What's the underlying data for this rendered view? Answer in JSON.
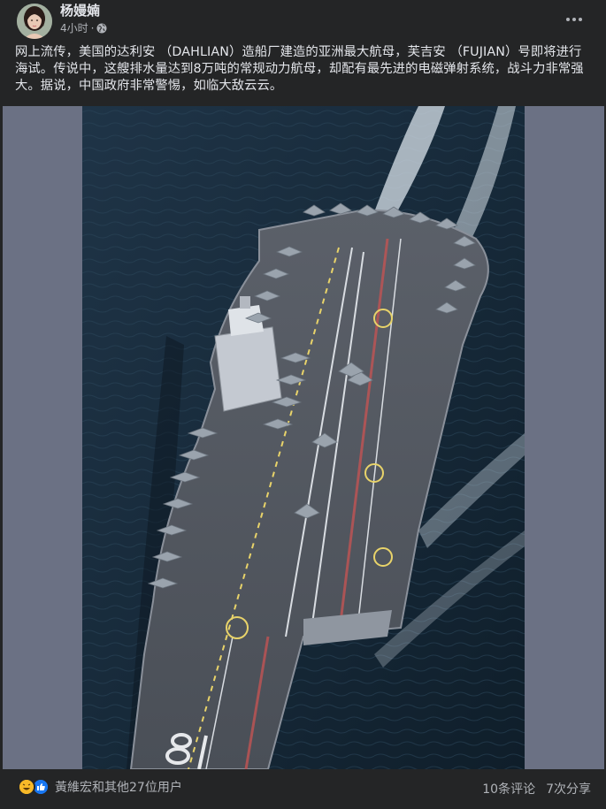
{
  "author": {
    "name": "杨嫚婻"
  },
  "post": {
    "time": "4小时",
    "separator": "·",
    "privacy_icon": "globe-icon",
    "text": "网上流传，美国的达利安 （DAHLIAN）造船厂建造的亚洲最大航母，芙吉安 （FUJIAN）号即将进行海试。传说中，这艘排水量达到8万吨的常规动力航母，却配有最先进的电磁弹射系统，战斗力非常强大。据说，中国政府非常警惕，如临大敌云云。",
    "image_subject": "aircraft-carrier-photo",
    "hull_number": "18"
  },
  "footer": {
    "reaction_icons": [
      "haha-icon",
      "like-icon"
    ],
    "reactions_text": "黃維宏和其他27位用户",
    "comments": "10条评论",
    "shares": "7次分享"
  },
  "colors": {
    "background": "#242526",
    "text_primary": "#e4e6eb",
    "text_secondary": "#b0b3b8",
    "media_frame": "#6b7184",
    "like_blue": "#1877f2",
    "haha_yellow": "#f7b928"
  }
}
